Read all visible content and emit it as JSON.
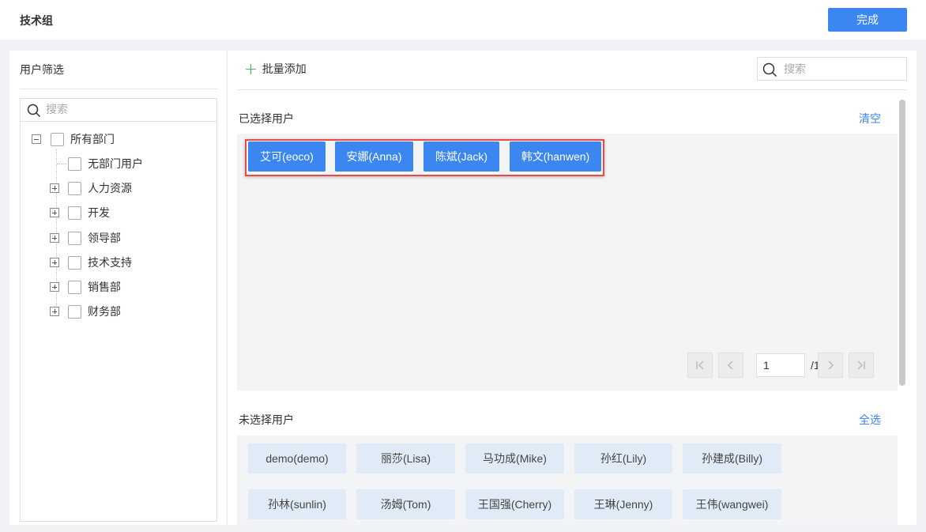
{
  "header": {
    "title": "技术组",
    "done_label": "完成"
  },
  "filter": {
    "title": "用户筛选",
    "search_placeholder": "搜索",
    "tree": {
      "root": "所有部门",
      "items": [
        "无部门用户",
        "人力资源",
        "开发",
        "领导部",
        "技术支持",
        "销售部",
        "财务部"
      ]
    }
  },
  "toolbar": {
    "batch_add_label": "批量添加",
    "search_placeholder": "搜索"
  },
  "selected": {
    "title": "已选择用户",
    "clear_label": "清空",
    "users": [
      "艾可(eoco)",
      "安娜(Anna)",
      "陈斌(Jack)",
      "韩文(hanwen)"
    ],
    "page": "1",
    "page_total": "/1"
  },
  "unselected": {
    "title": "未选择用户",
    "select_all_label": "全选",
    "users": [
      "demo(demo)",
      "丽莎(Lisa)",
      "马功成(Mike)",
      "孙红(Lily)",
      "孙建成(Billy)",
      "孙林(sunlin)",
      "汤姆(Tom)",
      "王国强(Cherry)",
      "王琳(Jenny)",
      "王伟(wangwei)"
    ]
  },
  "colors": {
    "primary": "#3b86f0",
    "highlight_border": "#e84a4a",
    "add_icon": "#2bb24c"
  }
}
